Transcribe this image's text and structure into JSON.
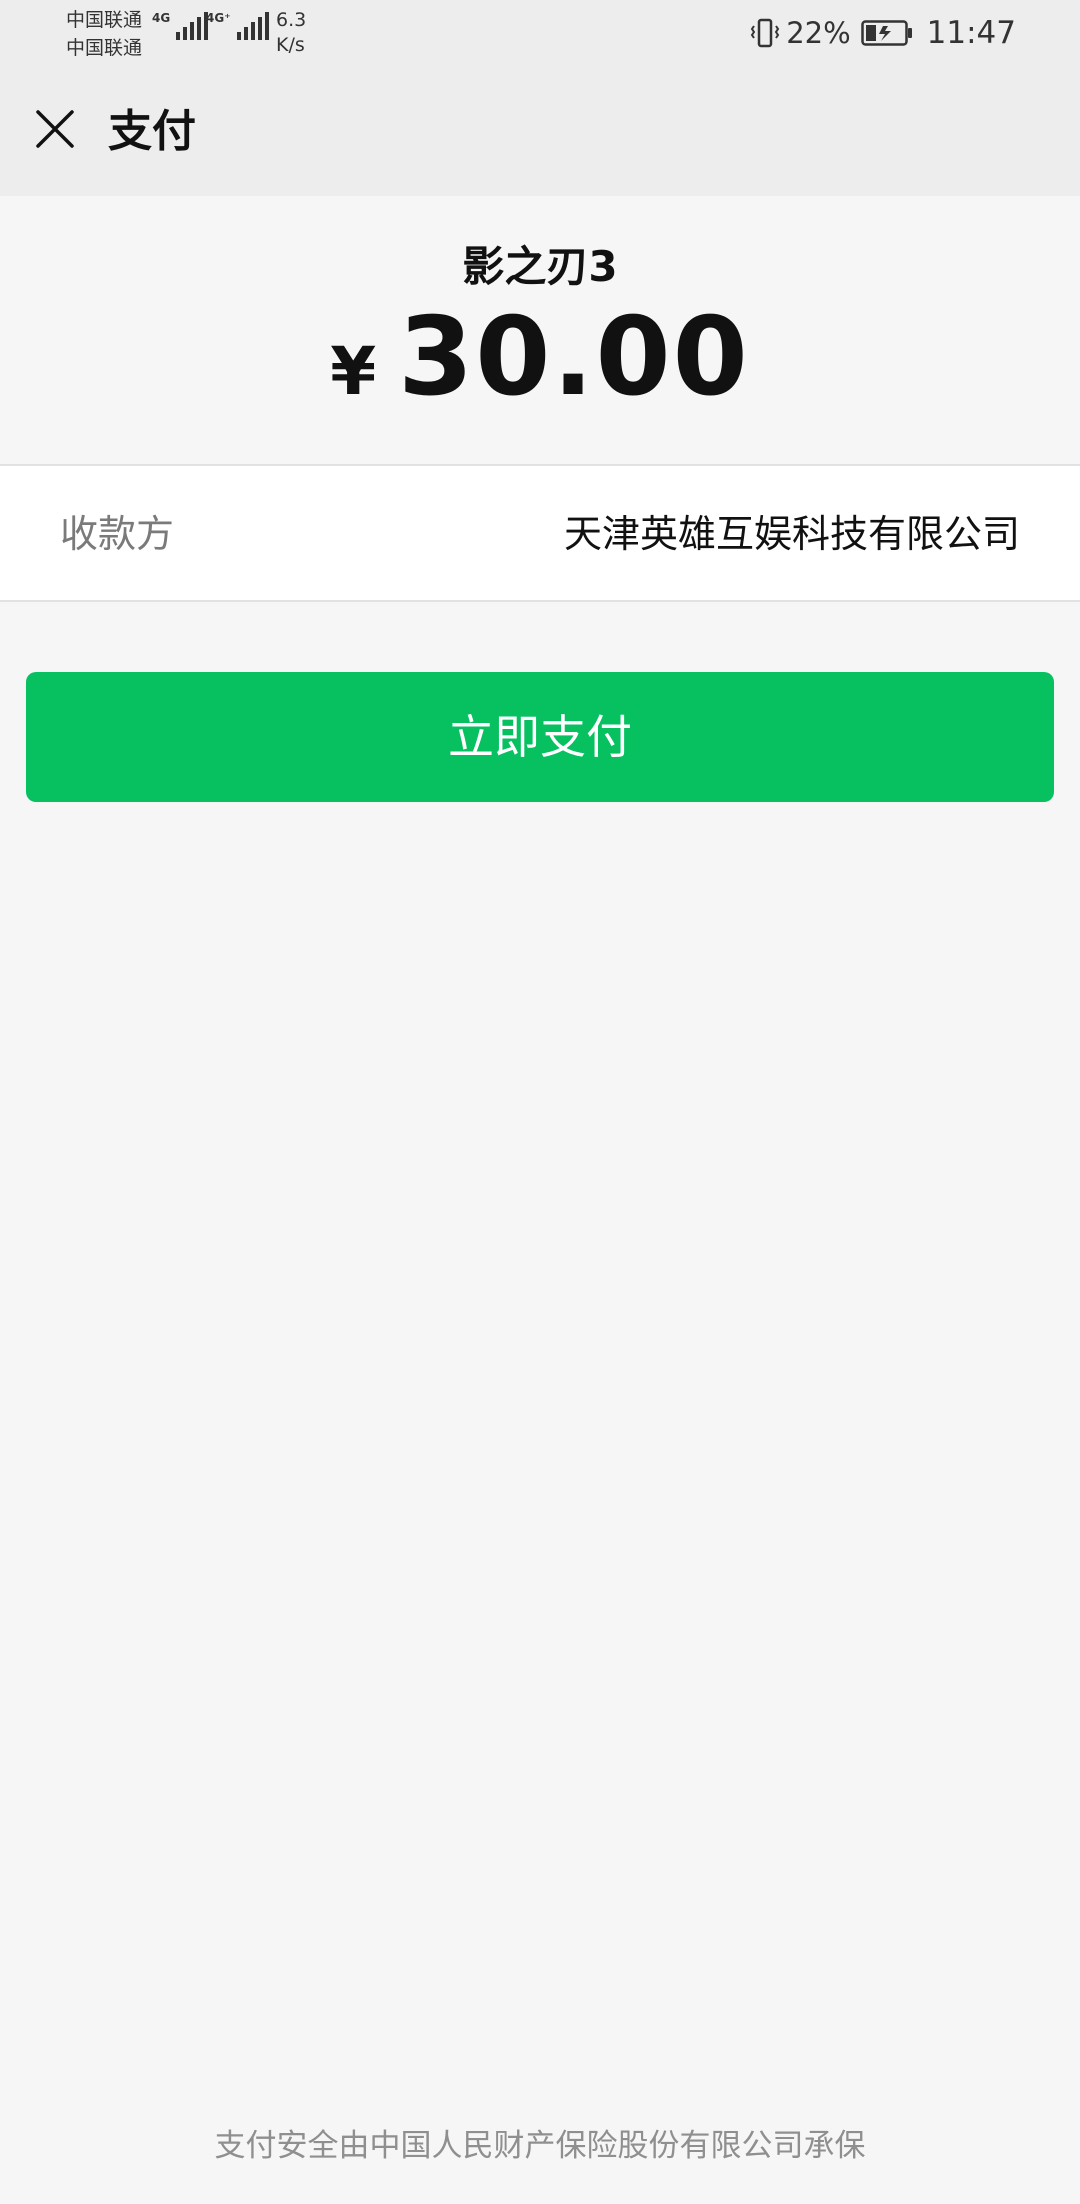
{
  "status_bar": {
    "carrier_1": "中国联通",
    "carrier_2": "中国联通",
    "network_1": "4G",
    "network_2": "4G⁺",
    "net_speed_value": "6.3",
    "net_speed_unit": "K/s",
    "battery_percent": "22%",
    "time": "11:47",
    "icons": [
      "signal-icon",
      "vibrate-icon",
      "battery-charging-icon"
    ]
  },
  "header": {
    "close_icon": "close-icon",
    "title": "支付"
  },
  "payment": {
    "product_name": "影之刃3",
    "currency_symbol": "¥",
    "amount": "30.00"
  },
  "payee": {
    "label": "收款方",
    "value": "天津英雄互娱科技有限公司"
  },
  "actions": {
    "pay_label": "立即支付"
  },
  "footer": {
    "note": "支付安全由中国人民财产保险股份有限公司承保"
  },
  "colors": {
    "primary_green": "#07c160",
    "header_bg": "#ededed",
    "page_bg": "#f6f6f6"
  }
}
